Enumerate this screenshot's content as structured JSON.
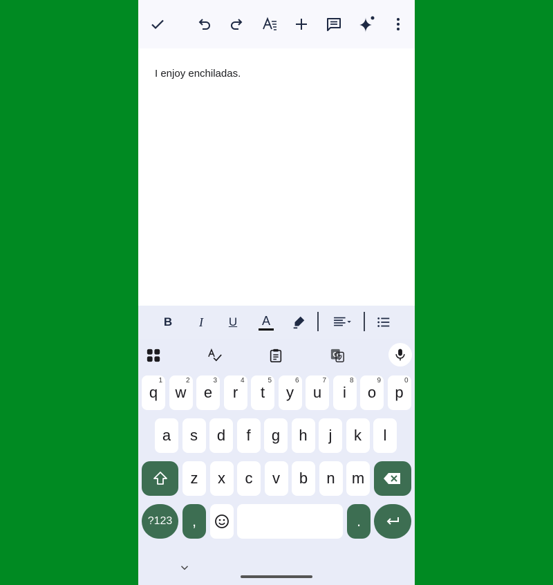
{
  "toolbar": {
    "icons": [
      "check-icon",
      "undo-icon",
      "redo-icon",
      "text-format-icon",
      "add-icon",
      "comment-icon",
      "gemini-sparkle-icon",
      "more-vert-icon"
    ]
  },
  "document": {
    "text": "I enjoy enchiladas."
  },
  "format_bar": {
    "icons": [
      "bold-icon",
      "italic-icon",
      "underline-icon",
      "text-color-icon",
      "highlight-icon",
      "align-dropdown-icon",
      "bulleted-list-icon"
    ],
    "bold_label": "B",
    "italic_label": "I",
    "underline_label": "U",
    "text_color_label": "A"
  },
  "keyboard": {
    "tools": [
      "apps-grid-icon",
      "spellcheck-icon",
      "clipboard-icon",
      "translate-icon",
      "mic-icon"
    ],
    "row1": [
      {
        "label": "q",
        "hint": "1"
      },
      {
        "label": "w",
        "hint": "2"
      },
      {
        "label": "e",
        "hint": "3"
      },
      {
        "label": "r",
        "hint": "4"
      },
      {
        "label": "t",
        "hint": "5"
      },
      {
        "label": "y",
        "hint": "6"
      },
      {
        "label": "u",
        "hint": "7"
      },
      {
        "label": "i",
        "hint": "8"
      },
      {
        "label": "o",
        "hint": "9"
      },
      {
        "label": "p",
        "hint": "0"
      }
    ],
    "row2": [
      "a",
      "s",
      "d",
      "f",
      "g",
      "h",
      "j",
      "k",
      "l"
    ],
    "row3": [
      "z",
      "x",
      "c",
      "v",
      "b",
      "n",
      "m"
    ],
    "symbols_label": "?123",
    "comma_label": ",",
    "period_label": ".",
    "colors": {
      "accent": "#3d6e52",
      "key": "#ffffff",
      "keyboard_bg": "#e9ecf8"
    }
  }
}
